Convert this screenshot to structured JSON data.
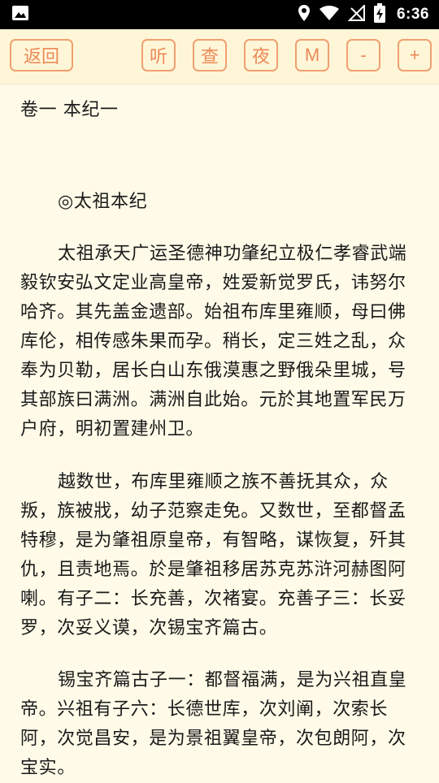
{
  "status_bar": {
    "time": "6:36",
    "icons": [
      "image-icon",
      "location-icon",
      "wifi-icon",
      "no-signal-icon",
      "battery-charging-icon"
    ]
  },
  "toolbar": {
    "back_label": "返回",
    "listen_label": "听",
    "lookup_label": "查",
    "night_label": "夜",
    "menu_label": "M",
    "font_decrease_label": "-",
    "font_increase_label": "+"
  },
  "content": {
    "chapter_title": "卷一 本纪一",
    "section_title": "◎太祖本纪",
    "paragraphs": [
      "太祖承天广运圣德神功肇纪立极仁孝睿武端毅钦安弘文定业高皇帝，姓爱新觉罗氏，讳努尔哈齐。其先盖金遗部。始祖布库里雍顺，母曰佛库伦，相传感朱果而孕。稍长，定三姓之乱，众奉为贝勒，居长白山东俄漠惠之野俄朵里城，号其部族曰满洲。满洲自此始。元於其地置军民万户府，明初置建州卫。",
      "越数世，布库里雍顺之族不善抚其众，众叛，族被戕，幼子范察走免。又数世，至都督孟特穆，是为肇祖原皇帝，有智略，谋恢复，歼其仇，且责地焉。於是肇祖移居苏克苏浒河赫图阿喇。有子二：长充善，次褚宴。充善子三：长妥罗，次妥义谟，次锡宝齐篇古。",
      "锡宝齐篇古子一：都督福满，是为兴祖直皇帝。兴祖有子六：长德世库，次刘阐，次索长阿，次觉昌安，是为景祖翼皇帝，次包朗阿，次宝实。"
    ]
  },
  "colors": {
    "toolbar_bg": "#FFF6D8",
    "page_bg": "#FFFBE8",
    "button_accent": "#EC8A58",
    "text": "#1A1A1A"
  }
}
